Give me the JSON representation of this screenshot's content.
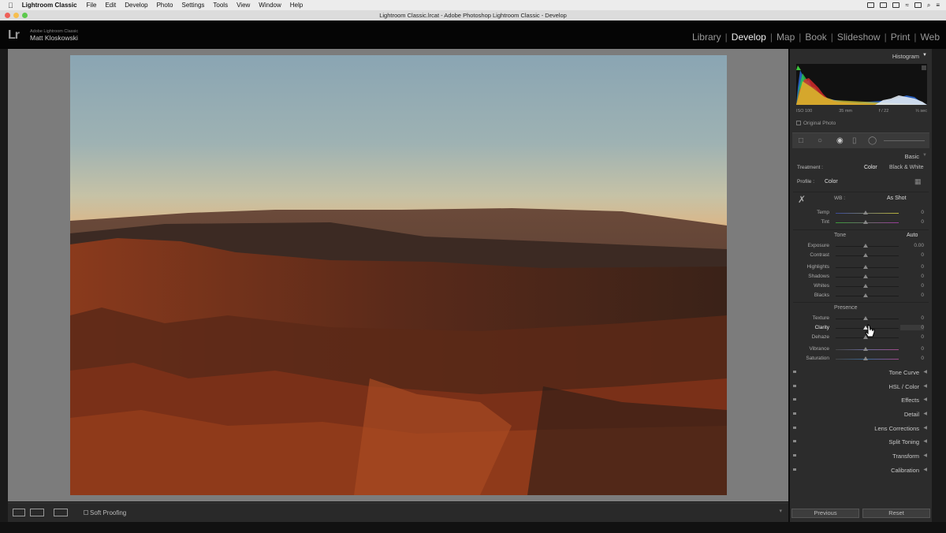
{
  "menubar": {
    "app_name": "Lightroom Classic",
    "items": [
      "File",
      "Edit",
      "Develop",
      "Photo",
      "Settings",
      "Tools",
      "View",
      "Window",
      "Help"
    ]
  },
  "window": {
    "title": "Lightroom Classic.lrcat - Adobe Photoshop Lightroom Classic - Develop"
  },
  "identity": {
    "logo": "Lr",
    "product": "Adobe Lightroom Classic",
    "user": "Matt Kloskowski"
  },
  "modules": {
    "items": [
      "Library",
      "Develop",
      "Map",
      "Book",
      "Slideshow",
      "Print",
      "Web"
    ],
    "active": "Develop"
  },
  "toolbar": {
    "soft_proofing_label": "Soft Proofing"
  },
  "panels": {
    "histogram": {
      "title": "Histogram",
      "iso": "ISO 100",
      "focal": "35 mm",
      "aperture": "f / 22",
      "shutter": "⅓ sec",
      "original_photo": "Original Photo"
    },
    "basic": {
      "title": "Basic",
      "treatment_label": "Treatment :",
      "treatment_color": "Color",
      "treatment_bw": "Black & White",
      "profile_label": "Profile :",
      "profile_value": "Color",
      "wb_label": "WB :",
      "wb_value": "As Shot",
      "tone_label": "Tone",
      "auto_label": "Auto",
      "presence_label": "Presence",
      "sliders": [
        {
          "label": "Temp",
          "value": "0"
        },
        {
          "label": "Tint",
          "value": "0"
        },
        {
          "label": "Exposure",
          "value": "0.00"
        },
        {
          "label": "Contrast",
          "value": "0"
        },
        {
          "label": "Highlights",
          "value": "0"
        },
        {
          "label": "Shadows",
          "value": "0"
        },
        {
          "label": "Whites",
          "value": "0"
        },
        {
          "label": "Blacks",
          "value": "0"
        },
        {
          "label": "Texture",
          "value": "0"
        },
        {
          "label": "Clarity",
          "value": "0"
        },
        {
          "label": "Dehaze",
          "value": "0"
        },
        {
          "label": "Vibrance",
          "value": "0"
        },
        {
          "label": "Saturation",
          "value": "0"
        }
      ]
    },
    "collapsed": [
      "Tone Curve",
      "HSL / Color",
      "Effects",
      "Detail",
      "Lens Corrections",
      "Split Toning",
      "Transform",
      "Calibration"
    ]
  },
  "buttons": {
    "previous": "Previous",
    "reset": "Reset"
  }
}
